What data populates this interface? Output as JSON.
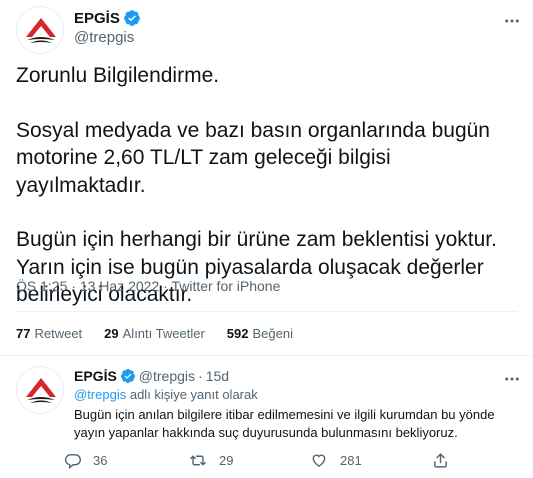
{
  "colors": {
    "accent": "#1d9bf0",
    "text": "#0f1419",
    "muted": "#536471",
    "divider": "#eff3f4",
    "logo_red": "#d4262b"
  },
  "tweet": {
    "display_name": "EPGİS",
    "handle": "@trepgis",
    "paragraphs": [
      "Zorunlu Bilgilendirme.",
      "Sosyal medyada ve bazı basın organlarında bugün motorine 2,60 TL/LT zam geleceği bilgisi yayılmaktadır.",
      "Bugün için herhangi bir ürüne zam beklentisi yoktur. Yarın için ise bugün piyasalarda oluşacak değerler belirleyici olacaktır."
    ],
    "time": "ÖS 1:25",
    "separator": "·",
    "date": "13 Haz 2022",
    "source": "Twitter for iPhone"
  },
  "stats": {
    "retweets_count": "77",
    "retweets_label": "Retweet",
    "quotes_count": "29",
    "quotes_label": "Alıntı Tweetler",
    "likes_count": "592",
    "likes_label": "Beğeni"
  },
  "reply": {
    "display_name": "EPGİS",
    "handle": "@trepgis",
    "separator": "·",
    "age": "15d",
    "replying_handle": "@trepgis",
    "replying_suffix": "adlı kişiye yanıt olarak",
    "text": "Bugün için anılan bilgilere itibar edilmemesini ve ilgili kurumdan bu yönde yayın yapanlar hakkında suç duyurusunda bulunmasını bekliyoruz.",
    "actions": {
      "replies": "36",
      "retweets": "29",
      "likes": "281"
    }
  },
  "icons": {
    "verified": "verified-badge-icon",
    "more": "more-options-icon",
    "reply": "reply-icon",
    "retweet": "retweet-icon",
    "like": "heart-icon",
    "share": "share-icon",
    "logo": "epgis-logo-icon"
  }
}
